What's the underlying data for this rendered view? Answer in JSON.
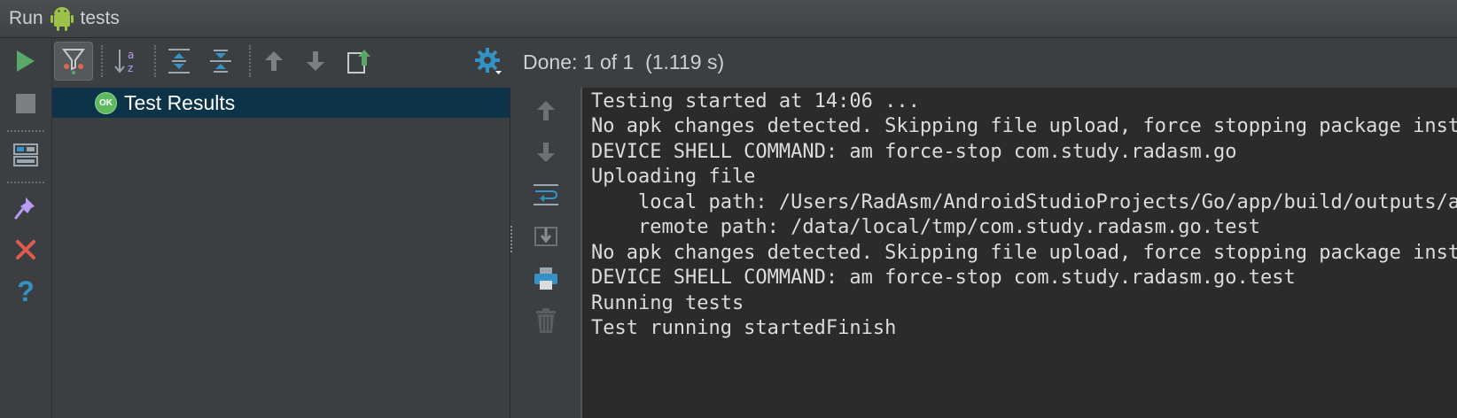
{
  "title_bar": {
    "run_label": "Run",
    "config_name": "tests",
    "config_icon": "android-icon"
  },
  "left_toolbar": {
    "buttons": [
      {
        "name": "rerun-button",
        "icon": "play-icon",
        "color": "#59a869"
      },
      {
        "name": "stop-button",
        "icon": "stop-icon",
        "color": "#8a8a8a"
      },
      {
        "name": "restore-layout-button",
        "icon": "layout-icon"
      },
      {
        "name": "pin-button",
        "icon": "pin-icon"
      },
      {
        "name": "close-button",
        "icon": "close-icon",
        "color": "#e05a4f"
      },
      {
        "name": "help-button",
        "icon": "help-icon",
        "color": "#3592c4"
      }
    ]
  },
  "toolbar": {
    "buttons": [
      {
        "name": "show-passed-toggle",
        "icon": "filter-icon",
        "active": true
      },
      {
        "name": "sort-alpha-button",
        "icon": "sort-az-icon"
      },
      {
        "name": "expand-all-button",
        "icon": "expand-all-icon"
      },
      {
        "name": "collapse-all-button",
        "icon": "collapse-all-icon"
      },
      {
        "name": "previous-failed-button",
        "icon": "arrow-up-icon"
      },
      {
        "name": "next-failed-button",
        "icon": "arrow-down-icon"
      },
      {
        "name": "export-results-button",
        "icon": "export-icon"
      },
      {
        "name": "settings-button",
        "icon": "gear-icon"
      }
    ],
    "status_text": "Done: 1 of 1  (1.119 s)"
  },
  "test_tree": {
    "root": {
      "status_badge": "OK",
      "label": "Test Results",
      "selected": true
    }
  },
  "console_actions": [
    {
      "name": "scroll-up-button",
      "icon": "arrow-up-icon"
    },
    {
      "name": "scroll-down-button",
      "icon": "arrow-down-icon"
    },
    {
      "name": "soft-wrap-button",
      "icon": "wrap-icon"
    },
    {
      "name": "scroll-to-end-button",
      "icon": "scroll-end-icon"
    },
    {
      "name": "print-button",
      "icon": "print-icon"
    },
    {
      "name": "clear-all-button",
      "icon": "trash-icon"
    }
  ],
  "console": {
    "lines": [
      "Testing started at 14:06 ...",
      "No apk changes detected. Skipping file upload, force stopping package instead.",
      "DEVICE SHELL COMMAND: am force-stop com.study.radasm.go",
      "Uploading file",
      "    local path: /Users/RadAsm/AndroidStudioProjects/Go/app/build/outputs/apk/app-debug-androidTest-unaligned.apk",
      "    remote path: /data/local/tmp/com.study.radasm.go.test",
      "No apk changes detected. Skipping file upload, force stopping package instead.",
      "DEVICE SHELL COMMAND: am force-stop com.study.radasm.go.test",
      "Running tests",
      "Test running startedFinish"
    ]
  },
  "colors": {
    "panel_bg": "#3c3f41",
    "console_bg": "#2b2b2b",
    "selection_bg": "#0d3349",
    "ok_green": "#5fb95f",
    "accent_blue": "#3592c4"
  }
}
